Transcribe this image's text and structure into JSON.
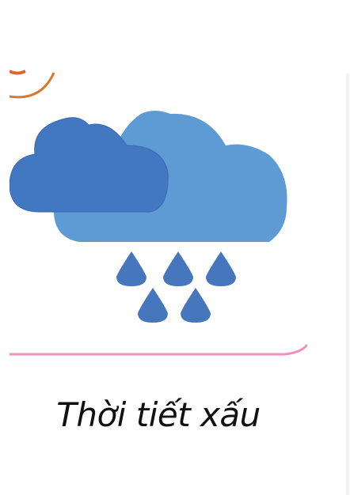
{
  "card": {
    "label": "Thời tiết xấu",
    "icon": "cloud-rain-icon",
    "colors": {
      "cloud_back": "#5e9ad3",
      "cloud_front": "#4178c1",
      "drops": "#4677bd",
      "sun_arc": "#d9772f",
      "card_border": "#f28fbf"
    }
  }
}
